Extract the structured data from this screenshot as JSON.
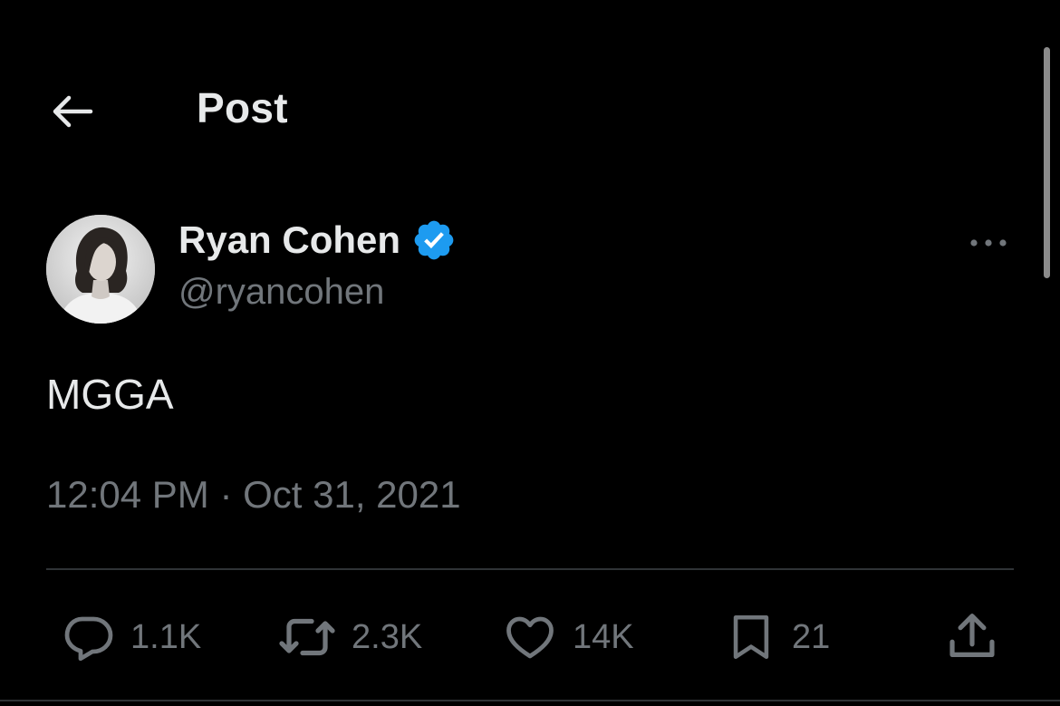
{
  "header": {
    "title": "Post",
    "back_icon": "arrow-left-icon"
  },
  "author": {
    "name": "Ryan Cohen",
    "handle": "@ryancohen",
    "verified": true,
    "verified_color": "#1d9bf0"
  },
  "post": {
    "text": "MGGA",
    "time": "12:04 PM",
    "separator": "·",
    "date": "Oct 31, 2021"
  },
  "actions": {
    "replies": {
      "icon": "reply-bubble-icon",
      "count": "1.1K"
    },
    "reposts": {
      "icon": "repost-icon",
      "count": "2.3K"
    },
    "likes": {
      "icon": "heart-icon",
      "count": "14K"
    },
    "bookmarks": {
      "icon": "bookmark-icon",
      "count": "21"
    },
    "share": {
      "icon": "share-icon"
    }
  },
  "colors": {
    "background": "#000000",
    "text_primary": "#e7e9ea",
    "text_secondary": "#71767b",
    "divider": "#2f3336"
  }
}
